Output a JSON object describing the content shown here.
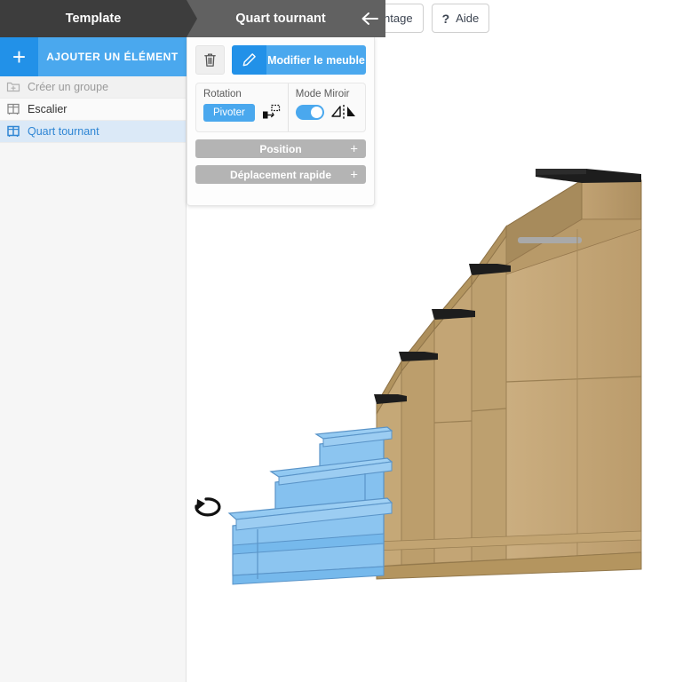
{
  "topbar": {
    "montage_label": "Montage",
    "help_label": "Aide",
    "help_icon": "question-mark-icon"
  },
  "header": {
    "left_title": "Template",
    "right_title": "Quart tournant",
    "back_icon": "arrow-left-icon",
    "colors": {
      "left_bg": "#3d3d3d",
      "right_bg": "#616161"
    }
  },
  "sidebar": {
    "add_button": {
      "plus": "+",
      "label": "AJOUTER UN ÉLÉMENT"
    },
    "items": [
      {
        "label": "Créer un groupe",
        "icon": "folder-plus-icon",
        "state": "muted"
      },
      {
        "label": "Escalier",
        "icon": "cabinet-icon",
        "state": "plain"
      },
      {
        "label": "Quart tournant",
        "icon": "cabinet-icon",
        "state": "selected"
      }
    ]
  },
  "properties": {
    "delete_icon": "trash-icon",
    "edit_icon": "pencil-icon",
    "edit_label": "Modifier le meuble",
    "rotation": {
      "title": "Rotation",
      "button_label": "Pivoter",
      "icon": "rotate-object-icon"
    },
    "mirror": {
      "title": "Mode Miroir",
      "toggle_on": true,
      "icon": "mirror-flip-icon"
    },
    "position_label": "Position",
    "position_plus": "+",
    "move_label": "Déplacement rapide",
    "move_plus": "+"
  },
  "canvas": {
    "rotation_handle_icon": "rotate-arrow-icon",
    "colors": {
      "selected_blue": "#7cbdee",
      "wood": "#c6a878",
      "tread_dark": "#1d1d1d"
    }
  }
}
